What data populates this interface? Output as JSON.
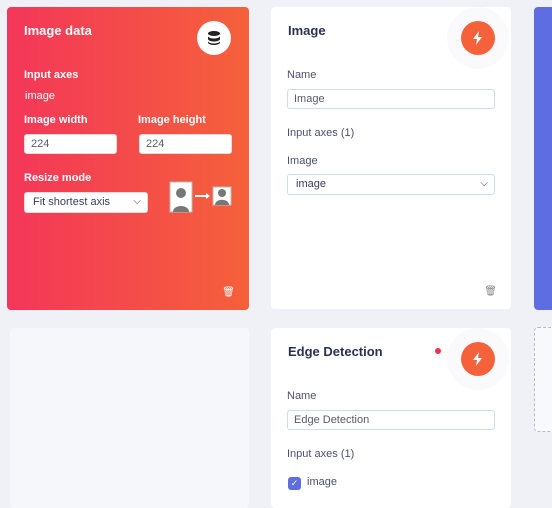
{
  "image_data": {
    "title": "Image data",
    "input_axes_label": "Input axes",
    "input_axes_value": "image",
    "width_label": "Image width",
    "width_value": "224",
    "height_label": "Image height",
    "height_value": "224",
    "resize_label": "Resize mode",
    "resize_value": "Fit shortest axis",
    "icon": "database-icon"
  },
  "image_node": {
    "title": "Image",
    "name_label": "Name",
    "name_value": "Image",
    "axes_label": "Input axes (1)",
    "image_label": "Image",
    "image_select": "image",
    "icon": "bolt-icon"
  },
  "edge_node": {
    "title": "Edge Detection",
    "name_label": "Name",
    "name_value": "Edge Detection",
    "axes_label": "Input axes (1)",
    "axis_checkbox": "image",
    "checked": true,
    "status_color": "#f0304f"
  },
  "colors": {
    "gradient_start": "#f4365a",
    "gradient_end": "#f5613a",
    "accent_blue": "#5e6ee2",
    "bolt": "#f5613a"
  }
}
